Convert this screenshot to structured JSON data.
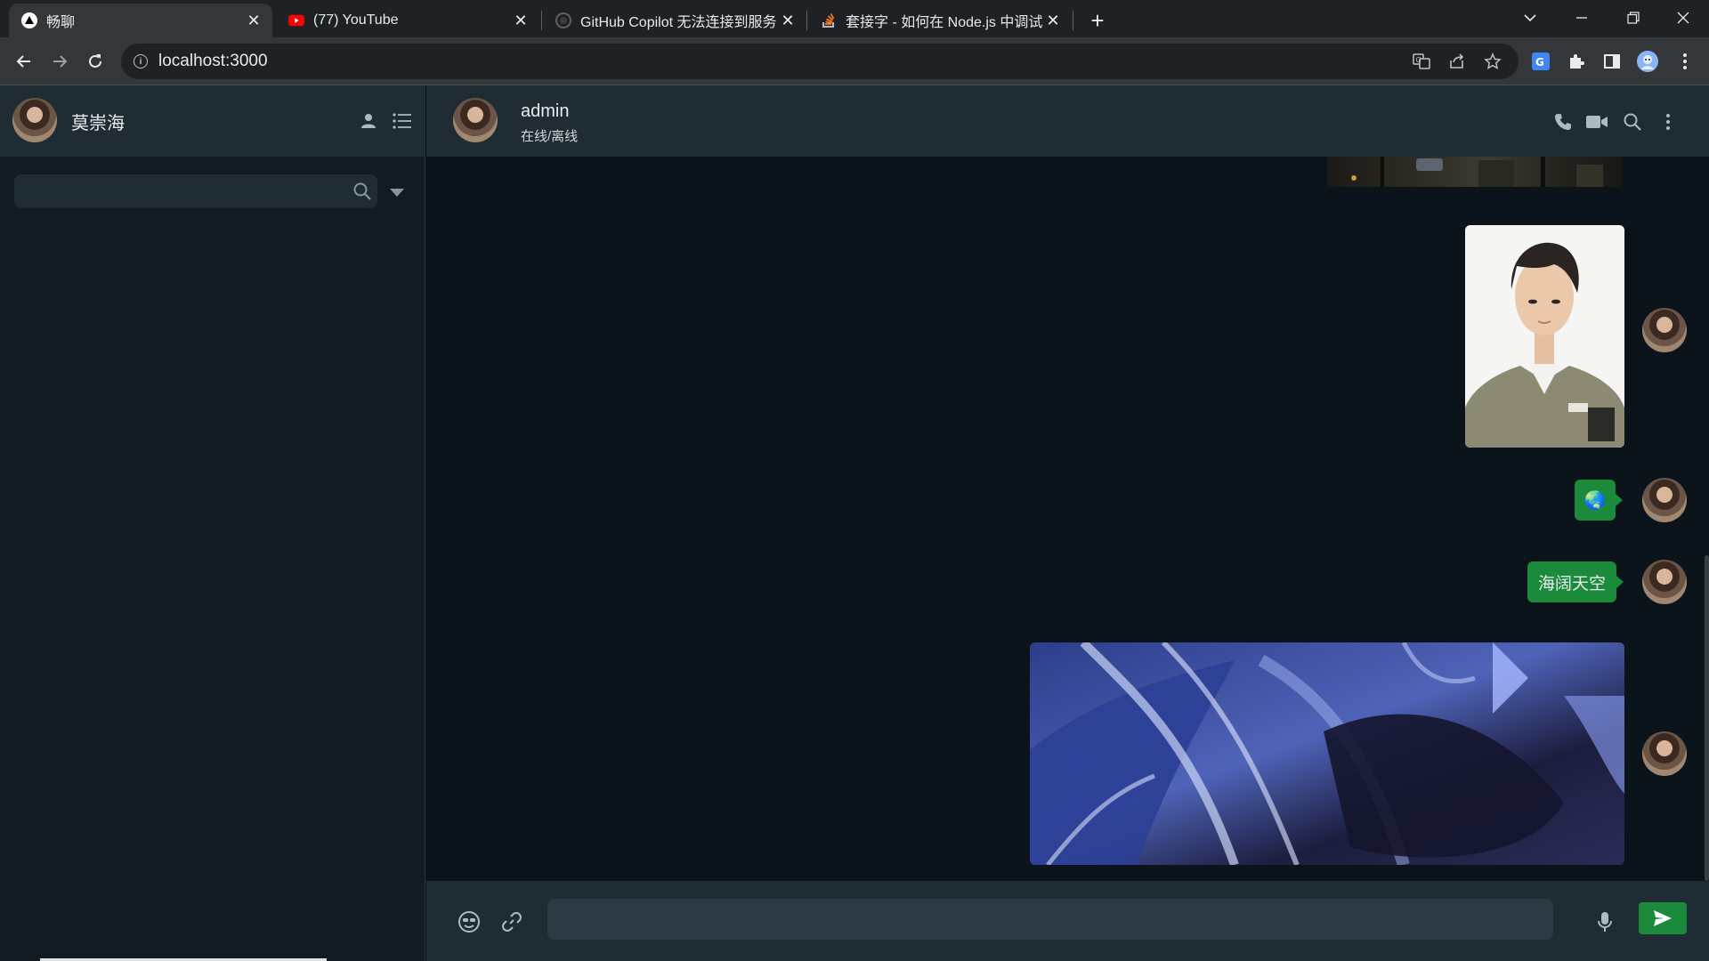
{
  "browser": {
    "tabs": [
      {
        "title": "畅聊",
        "favicon": "vercel-triangle-icon",
        "active": true
      },
      {
        "title": "(77) YouTube",
        "favicon": "youtube-icon",
        "active": false
      },
      {
        "title": "GitHub Copilot 无法连接到服务",
        "favicon": "github-icon",
        "active": false
      },
      {
        "title": "套接字 - 如何在 Node.js 中调试",
        "favicon": "stackoverflow-icon",
        "active": false
      }
    ],
    "url": "localhost:3000"
  },
  "sidebar": {
    "user_name": "莫崇海",
    "search_placeholder": ""
  },
  "chat": {
    "contact_name": "admin",
    "contact_status": "在线/离线",
    "messages": [
      {
        "type": "image",
        "desc": "street-photo"
      },
      {
        "type": "image",
        "desc": "portrait-photo"
      },
      {
        "type": "emoji",
        "icon": "earth-globe-icon",
        "text": "🌏"
      },
      {
        "type": "text",
        "text": "海阔天空"
      },
      {
        "type": "image",
        "desc": "blue-anime-artwork"
      }
    ],
    "composer_placeholder": ""
  },
  "colors": {
    "accent_green": "#1b8a3b",
    "panel": "#202c33",
    "background": "#0b141a"
  }
}
